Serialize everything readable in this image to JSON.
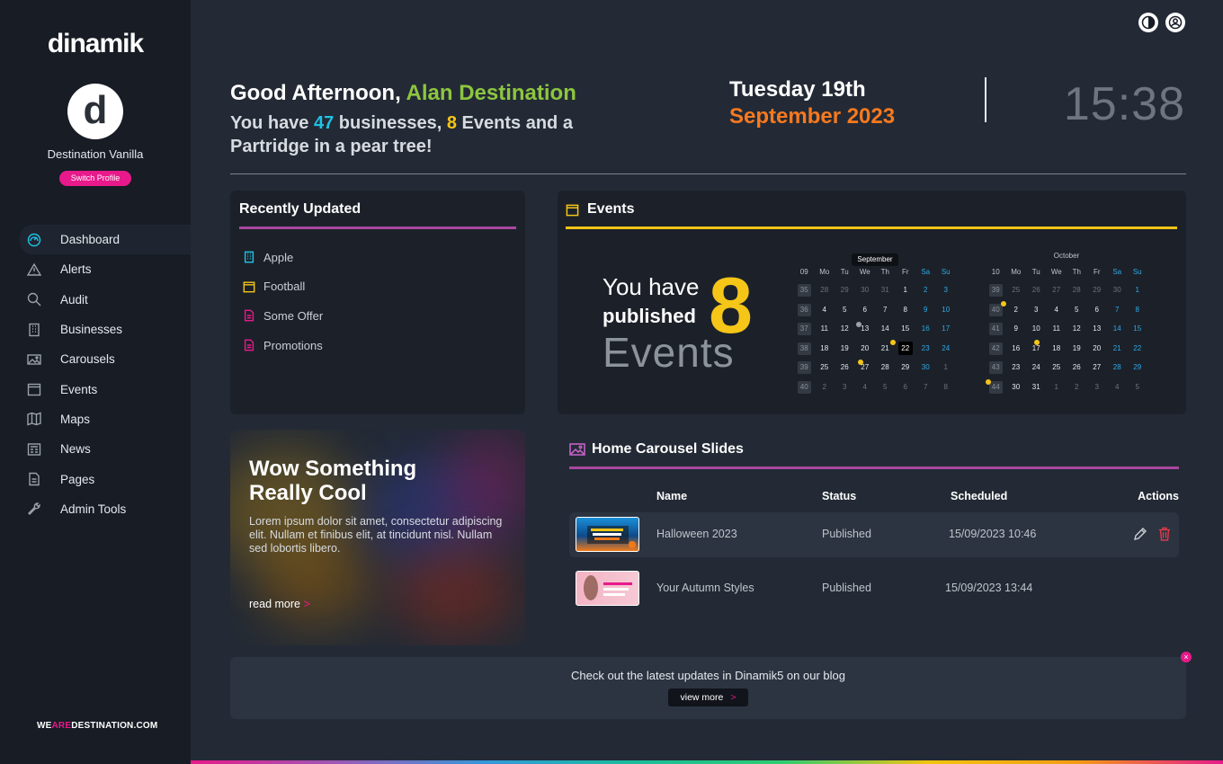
{
  "brand": {
    "logo": "dinamik",
    "footer_we": "WE",
    "footer_are": "ARE",
    "footer_dest": "DESTINATION.COM"
  },
  "profile": {
    "initial": "d",
    "name": "Destination Vanilla",
    "switch_label": "Switch Profile"
  },
  "nav": [
    {
      "label": "Dashboard",
      "icon": "dashboard-icon",
      "active": true
    },
    {
      "label": "Alerts",
      "icon": "alert-icon"
    },
    {
      "label": "Audit",
      "icon": "search-icon"
    },
    {
      "label": "Businesses",
      "icon": "building-icon"
    },
    {
      "label": "Carousels",
      "icon": "image-icon"
    },
    {
      "label": "Events",
      "icon": "calendar-icon"
    },
    {
      "label": "Maps",
      "icon": "map-icon"
    },
    {
      "label": "News",
      "icon": "newspaper-icon"
    },
    {
      "label": "Pages",
      "icon": "page-icon"
    },
    {
      "label": "Admin Tools",
      "icon": "wrench-icon"
    }
  ],
  "header": {
    "greeting_prefix": "Good Afternoon, ",
    "user_name": "Alan Destination",
    "summary_a": "You have ",
    "business_count": "47",
    "summary_b": " businesses, ",
    "event_count": "8",
    "summary_c": " Events and a Partridge in a pear tree!",
    "day_line": "Tuesday 19th",
    "month_line": "September 2023",
    "time": "15:38"
  },
  "recent": {
    "title": "Recently Updated",
    "items": [
      {
        "label": "Apple",
        "icon": "building-icon",
        "color": "#1ec3e6"
      },
      {
        "label": "Football",
        "icon": "calendar-icon",
        "color": "#f5c518"
      },
      {
        "label": "Some Offer",
        "icon": "page-icon",
        "color": "#e8198b"
      },
      {
        "label": "Promotions",
        "icon": "page-icon",
        "color": "#e8198b"
      }
    ]
  },
  "events": {
    "title": "Events",
    "line1": "You have",
    "line2": "published",
    "count": "8",
    "line3": "Events",
    "calendars": [
      {
        "month": "September",
        "head": [
          "09",
          "Mo",
          "Tu",
          "We",
          "Th",
          "Fr",
          "Sa",
          "Su"
        ],
        "rows": [
          [
            "35",
            "28",
            "29",
            "30",
            "31",
            "1",
            "2",
            "3"
          ],
          [
            "36",
            "4",
            "5",
            "6",
            "7",
            "8",
            "9",
            "10"
          ],
          [
            "37",
            "11",
            "12",
            "13",
            "14",
            "15",
            "16",
            "17"
          ],
          [
            "38",
            "18",
            "19",
            "20",
            "21",
            "22",
            "23",
            "24"
          ],
          [
            "39",
            "25",
            "26",
            "27",
            "28",
            "29",
            "30",
            "1"
          ],
          [
            "40",
            "2",
            "3",
            "4",
            "5",
            "6",
            "7",
            "8"
          ]
        ]
      },
      {
        "month": "October",
        "head": [
          "10",
          "Mo",
          "Tu",
          "We",
          "Th",
          "Fr",
          "Sa",
          "Su"
        ],
        "rows": [
          [
            "39",
            "25",
            "26",
            "27",
            "28",
            "29",
            "30",
            "1"
          ],
          [
            "40",
            "2",
            "3",
            "4",
            "5",
            "6",
            "7",
            "8"
          ],
          [
            "41",
            "9",
            "10",
            "11",
            "12",
            "13",
            "14",
            "15"
          ],
          [
            "42",
            "16",
            "17",
            "18",
            "19",
            "20",
            "21",
            "22"
          ],
          [
            "43",
            "23",
            "24",
            "25",
            "26",
            "27",
            "28",
            "29"
          ],
          [
            "44",
            "30",
            "31",
            "1",
            "2",
            "3",
            "4",
            "5"
          ]
        ]
      }
    ]
  },
  "promo": {
    "title_line1": "Wow Something",
    "title_line2": "Really Cool",
    "body": "Lorem ipsum dolor sit amet, consectetur adipiscing elit. Nullam et finibus elit, at tincidunt nisl. Nullam sed lobortis libero.",
    "link": "read more",
    "link_chev": ">"
  },
  "carousel": {
    "title": "Home Carousel Slides",
    "columns": {
      "name": "Name",
      "status": "Status",
      "scheduled": "Scheduled",
      "actions": "Actions"
    },
    "rows": [
      {
        "name": "Halloween 2023",
        "status": "Published",
        "scheduled": "15/09/2023 10:46"
      },
      {
        "name": "Your Autumn Styles",
        "status": "Published",
        "scheduled": "15/09/2023 13:44"
      }
    ]
  },
  "blog": {
    "text": "Check out the latest updates in Dinamik5 on our blog",
    "button": "view more",
    "button_chev": ">",
    "close": "×"
  },
  "colors": {
    "accent_pink": "#e8198b",
    "accent_green": "#8dc63f",
    "accent_cyan": "#1ec3e6",
    "accent_yellow": "#f5c518",
    "accent_orange": "#f7791f",
    "accent_purple": "#a9479f"
  }
}
